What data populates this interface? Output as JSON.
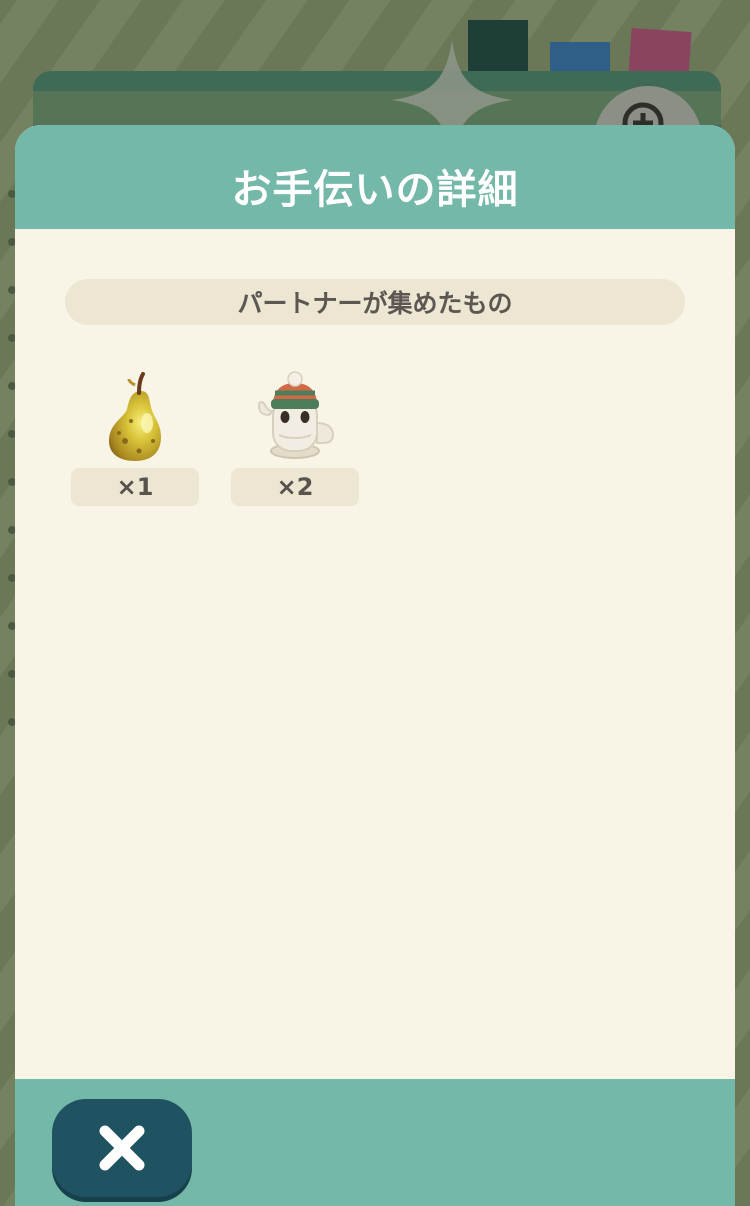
{
  "dialog": {
    "title": "お手伝いの詳細",
    "section_label": "パートナーが集めたもの",
    "items": [
      {
        "icon": "pear-icon",
        "count": "×1"
      },
      {
        "icon": "cactus-knit-hat-icon",
        "count": "×2"
      }
    ],
    "close_icon": "close-x-icon"
  },
  "colors": {
    "header": "#74b8aa",
    "panel": "#f8f5e7",
    "pill": "#ece6d3",
    "close_button": "#1f5361"
  }
}
